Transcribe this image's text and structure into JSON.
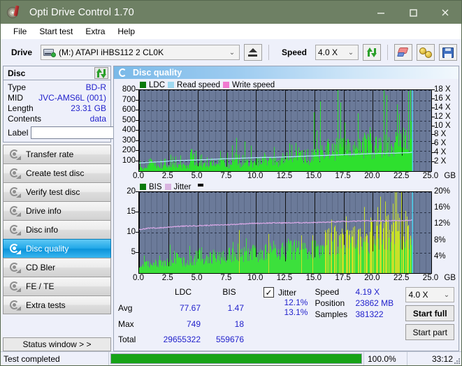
{
  "window": {
    "title": "Opti Drive Control 1.70",
    "app_icon": "disc-pen-icon",
    "minimize": "minimize-icon",
    "maximize": "maximize-icon",
    "close": "close-icon"
  },
  "menu": {
    "items": [
      "File",
      "Start test",
      "Extra",
      "Help"
    ]
  },
  "toolbar": {
    "drive_label": "Drive",
    "drive_value": "(M:)  ATAPI iHBS112  2 CL0K",
    "eject_title": "eject-icon",
    "speed_label": "Speed",
    "speed_value": "4.0 X",
    "refresh_title": "refresh-icon",
    "erase_title": "eraser-icon",
    "gold_title": "coins-icon",
    "save_title": "save-icon"
  },
  "disc": {
    "header": "Disc",
    "refresh_btn": "refresh-disc-icon",
    "rows": [
      {
        "key": "Type",
        "value": "BD-R"
      },
      {
        "key": "MID",
        "value": "JVC-AMS6L (001)"
      },
      {
        "key": "Length",
        "value": "23.31 GB"
      },
      {
        "key": "Contents",
        "value": "data"
      }
    ],
    "label_key": "Label",
    "label_value": "",
    "label_placeholder": ""
  },
  "nav": {
    "items": [
      {
        "label": "Transfer rate",
        "active": false
      },
      {
        "label": "Create test disc",
        "active": false
      },
      {
        "label": "Verify test disc",
        "active": false
      },
      {
        "label": "Drive info",
        "active": false
      },
      {
        "label": "Disc info",
        "active": false
      },
      {
        "label": "Disc quality",
        "active": true
      },
      {
        "label": "CD Bler",
        "active": false
      },
      {
        "label": "FE / TE",
        "active": false
      },
      {
        "label": "Extra tests",
        "active": false
      }
    ],
    "status_window": "Status window > >"
  },
  "content": {
    "header": "Disc quality",
    "header_icon": "disc-quality-icon"
  },
  "chart_data": [
    {
      "type": "area",
      "id": "ldc-chart",
      "title": "",
      "legend": [
        {
          "label": "LDC",
          "color": "#0a7a0a"
        },
        {
          "label": "Read speed",
          "color": "#9fd8f0"
        },
        {
          "label": "Write speed",
          "color": "#f07ad0"
        }
      ],
      "legend_position": "top-left",
      "xlabel": "GB",
      "x_ticks": [
        "0.0",
        "2.5",
        "5.0",
        "7.5",
        "10.0",
        "12.5",
        "15.0",
        "17.5",
        "20.0",
        "22.5",
        "25.0"
      ],
      "xlim": [
        0,
        25
      ],
      "ylabel_left": "LDC",
      "y_ticks_left": [
        "100",
        "200",
        "300",
        "400",
        "500",
        "600",
        "700",
        "800"
      ],
      "ylim_left": [
        0,
        800
      ],
      "ylabel_right": "Speed",
      "y_ticks_right": [
        "2 X",
        "4 X",
        "6 X",
        "8 X",
        "10 X",
        "12 X",
        "14 X",
        "16 X",
        "18 X"
      ],
      "ylim_right": [
        0,
        18
      ],
      "grid": true,
      "plot_bg": "#6b7a99",
      "data_end_gb": 23.4,
      "series": [
        {
          "name": "LDC",
          "color": "#2ee02e",
          "x": [
            0.0,
            0.3,
            0.6,
            0.9,
            1.0,
            1.2,
            1.5,
            1.8,
            2.1,
            2.4,
            2.7,
            3.0,
            3.3,
            3.6,
            3.9,
            4.2,
            4.5,
            4.8,
            5.1,
            5.4,
            5.7,
            5.9,
            6.2,
            6.5,
            6.8,
            7.1,
            7.4,
            7.7,
            8.0,
            8.3,
            8.6,
            8.9,
            9.2,
            9.5,
            9.8,
            10.1,
            10.4,
            10.7,
            11.0,
            11.3,
            11.6,
            11.9,
            12.2,
            12.5,
            12.8,
            13.1,
            13.4,
            13.7,
            14.0,
            14.3,
            14.6,
            14.9,
            15.2,
            15.5,
            15.8,
            16.1,
            16.4,
            16.7,
            17.0,
            17.3,
            17.6,
            17.9,
            18.2,
            18.5,
            18.8,
            19.1,
            19.4,
            19.7,
            20.0,
            20.3,
            20.6,
            20.9,
            21.2,
            21.5,
            21.8,
            22.1,
            22.4,
            22.7,
            23.0,
            23.3,
            23.4
          ],
          "values": [
            60,
            70,
            95,
            130,
            300,
            180,
            110,
            95,
            90,
            100,
            105,
            115,
            95,
            120,
            110,
            100,
            410,
            120,
            115,
            110,
            130,
            95,
            200,
            110,
            190,
            410,
            120,
            105,
            410,
            300,
            120,
            135,
            330,
            150,
            140,
            200,
            170,
            260,
            230,
            180,
            270,
            200,
            250,
            300,
            230,
            250,
            400,
            330,
            290,
            350,
            250,
            380,
            300,
            420,
            340,
            480,
            520,
            430,
            650,
            500,
            560,
            470,
            620,
            540,
            500,
            600,
            480,
            660,
            520,
            700,
            580,
            640,
            560,
            600,
            520,
            680,
            560,
            640,
            600,
            800,
            300
          ]
        },
        {
          "name": "Read speed",
          "color": "#aee6fa",
          "x": [
            0.0,
            1.0,
            2.0,
            3.0,
            4.0,
            5.0,
            6.0,
            7.0,
            8.0,
            9.0,
            10.0,
            11.0,
            12.0,
            13.0,
            14.0,
            15.0,
            16.0,
            17.0,
            18.0,
            19.0,
            20.0,
            21.0,
            22.0,
            23.0,
            23.4
          ],
          "values": [
            1.8,
            2.0,
            2.1,
            2.3,
            2.4,
            2.5,
            2.6,
            2.7,
            2.8,
            2.9,
            3.0,
            3.05,
            3.1,
            3.2,
            3.3,
            3.4,
            3.5,
            3.6,
            3.7,
            3.8,
            3.9,
            3.95,
            4.0,
            4.1,
            4.19
          ]
        },
        {
          "name": "Write speed",
          "color": "#f07ad0",
          "x": [],
          "values": []
        }
      ]
    },
    {
      "type": "area",
      "id": "bis-chart",
      "title": "",
      "legend": [
        {
          "label": "BIS",
          "color": "#0a7a0a"
        },
        {
          "label": "Jitter",
          "color": "#d9b4e0"
        }
      ],
      "legend_position": "top-left",
      "xlabel": "GB",
      "x_ticks": [
        "0.0",
        "2.5",
        "5.0",
        "7.5",
        "10.0",
        "12.5",
        "15.0",
        "17.5",
        "20.0",
        "22.5",
        "25.0"
      ],
      "xlim": [
        0,
        25
      ],
      "ylabel_left": "BIS",
      "y_ticks_left": [
        "5",
        "10",
        "15",
        "20"
      ],
      "ylim_left": [
        0,
        20
      ],
      "ylabel_right": "Jitter",
      "y_ticks_right": [
        "4%",
        "8%",
        "12%",
        "16%",
        "20%"
      ],
      "ylim_right": [
        0,
        20
      ],
      "grid": true,
      "plot_bg": "#6b7a99",
      "data_end_gb": 23.4,
      "series": [
        {
          "name": "BIS",
          "color": "#3ce03c",
          "x": [
            0.0,
            0.4,
            0.8,
            1.2,
            1.6,
            2.0,
            2.4,
            2.8,
            3.2,
            3.6,
            4.0,
            4.4,
            4.8,
            5.2,
            5.6,
            6.0,
            6.4,
            6.8,
            7.2,
            7.6,
            8.0,
            8.4,
            8.8,
            9.2,
            9.6,
            10.0,
            10.4,
            10.8,
            11.2,
            11.6,
            12.0,
            12.4,
            12.8,
            13.2,
            13.6,
            14.0,
            14.4,
            14.8,
            15.2,
            15.6,
            16.0,
            16.4,
            16.8,
            17.2,
            17.6,
            18.0,
            18.4,
            18.8,
            19.2,
            19.6,
            20.0,
            20.4,
            20.8,
            21.2,
            21.6,
            22.0,
            22.4,
            22.8,
            23.2,
            23.4
          ],
          "values": [
            2.5,
            3.5,
            3.0,
            4.0,
            3.2,
            3.8,
            4.5,
            5.0,
            6.0,
            4.5,
            4.0,
            5.2,
            4.4,
            7.5,
            4.8,
            5.0,
            6.5,
            5.5,
            6.0,
            7.0,
            6.2,
            8.0,
            6.5,
            7.5,
            8.5,
            7.0,
            8.0,
            7.5,
            9.0,
            8.0,
            8.5,
            7.8,
            9.2,
            8.5,
            9.0,
            10.5,
            9.5,
            10.0,
            9.2,
            10.2,
            12.0,
            11.0,
            12.5,
            11.5,
            12.0,
            11.0,
            12.8,
            11.5,
            13.0,
            12.0,
            14.0,
            18.0,
            13.0,
            15.0,
            14.5,
            17.0,
            13.5,
            16.0,
            12.5,
            8.0
          ]
        },
        {
          "name": "Jitter",
          "color": "#dba9e8",
          "x": [
            0.0,
            1.0,
            2.0,
            3.0,
            4.0,
            5.0,
            6.0,
            7.0,
            8.0,
            9.0,
            10.0,
            11.0,
            12.0,
            13.0,
            14.0,
            15.0,
            16.0,
            17.0,
            18.0,
            19.0,
            20.0,
            21.0,
            22.0,
            23.0,
            23.4
          ],
          "values": [
            10.8,
            11.1,
            11.2,
            11.5,
            11.6,
            11.7,
            11.8,
            11.9,
            12.0,
            12.2,
            12.3,
            12.35,
            12.4,
            12.4,
            12.45,
            12.5,
            12.55,
            12.7,
            12.75,
            12.85,
            12.9,
            12.9,
            12.95,
            13.0,
            13.1
          ]
        }
      ]
    }
  ],
  "stats": {
    "headers": {
      "blank": "",
      "ldc": "LDC",
      "bis": "BIS",
      "jitter": "Jitter"
    },
    "jitter_checked": true,
    "jitter_check_glyph": "✓",
    "rows": [
      {
        "label": "Avg",
        "ldc": "77.67",
        "bis": "1.47",
        "jitter": "12.1%"
      },
      {
        "label": "Max",
        "ldc": "749",
        "bis": "18",
        "jitter": "13.1%"
      },
      {
        "label": "Total",
        "ldc": "29655322",
        "bis": "559676",
        "jitter": ""
      }
    ],
    "speed_label": "Speed",
    "speed_value": "4.19 X",
    "position_label": "Position",
    "position_value": "23862 MB",
    "samples_label": "Samples",
    "samples_value": "381322",
    "speed_select": "4.0 X",
    "start_full": "Start full",
    "start_part": "Start part"
  },
  "statusbar": {
    "message": "Test completed",
    "progress_percent": 100,
    "progress_text": "100.0%",
    "elapsed": "33:12",
    "progress_color": "#17a317"
  }
}
